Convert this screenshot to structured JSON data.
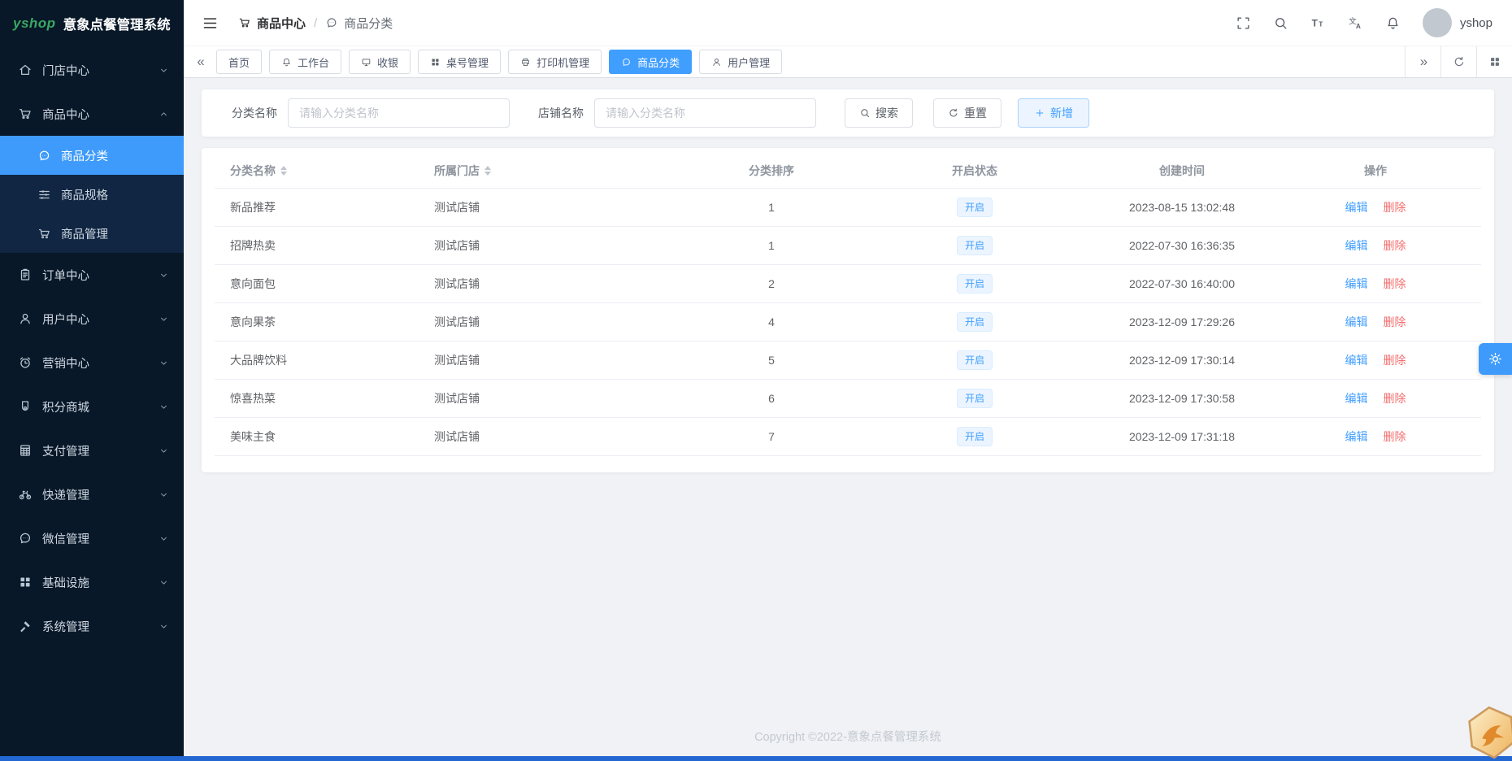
{
  "colors": {
    "accent": "#409eff",
    "sidebar_bg": "#081828",
    "submenu_bg": "#102642",
    "danger": "#f56c6c",
    "badge_bg": "#ecf5ff"
  },
  "app": {
    "logo_text": "yshop",
    "title": "意象点餐管理系统",
    "username": "yshop"
  },
  "header": {
    "breadcrumb": [
      {
        "icon": "cart",
        "label": "商品中心"
      },
      {
        "icon": "comment",
        "label": "商品分类"
      }
    ]
  },
  "sidebar": {
    "items": [
      {
        "icon": "home",
        "label": "门店中心",
        "chevron": "down"
      },
      {
        "icon": "cart",
        "label": "商品中心",
        "chevron": "up",
        "expanded": true,
        "children": [
          {
            "icon": "comment",
            "label": "商品分类",
            "active": true
          },
          {
            "icon": "sliders",
            "label": "商品规格"
          },
          {
            "icon": "cart",
            "label": "商品管理"
          }
        ]
      },
      {
        "icon": "clipboard",
        "label": "订单中心",
        "chevron": "down"
      },
      {
        "icon": "user",
        "label": "用户中心",
        "chevron": "down"
      },
      {
        "icon": "alarm",
        "label": "营销中心",
        "chevron": "down"
      },
      {
        "icon": "medal",
        "label": "积分商城",
        "chevron": "down"
      },
      {
        "icon": "calculator",
        "label": "支付管理",
        "chevron": "down"
      },
      {
        "icon": "bike",
        "label": "快递管理",
        "chevron": "down"
      },
      {
        "icon": "comment",
        "label": "微信管理",
        "chevron": "down"
      },
      {
        "icon": "grid",
        "label": "基础设施",
        "chevron": "down"
      },
      {
        "icon": "gavel",
        "label": "系统管理",
        "chevron": "down"
      }
    ]
  },
  "tabs": [
    {
      "label": "首页"
    },
    {
      "icon": "bell",
      "label": "工作台"
    },
    {
      "icon": "monitor",
      "label": "收银"
    },
    {
      "icon": "grid",
      "label": "桌号管理"
    },
    {
      "icon": "printer",
      "label": "打印机管理"
    },
    {
      "icon": "comment",
      "label": "商品分类",
      "active": true
    },
    {
      "icon": "user",
      "label": "用户管理"
    }
  ],
  "filters": {
    "category_label": "分类名称",
    "category_placeholder": "请输入分类名称",
    "shop_label": "店铺名称",
    "shop_placeholder": "请输入分类名称",
    "search_button": "搜索",
    "reset_button": "重置",
    "add_button": "新增"
  },
  "table": {
    "columns": [
      {
        "label": "分类名称",
        "sortable": true
      },
      {
        "label": "所属门店",
        "sortable": true
      },
      {
        "label": "分类排序"
      },
      {
        "label": "开启状态"
      },
      {
        "label": "创建时间"
      },
      {
        "label": "操作"
      }
    ],
    "edit_label": "编辑",
    "delete_label": "删除",
    "rows": [
      {
        "name": "新品推荐",
        "shop": "测试店铺",
        "sort": "1",
        "status": "开启",
        "created": "2023-08-15 13:02:48"
      },
      {
        "name": "招牌热卖",
        "shop": "测试店铺",
        "sort": "1",
        "status": "开启",
        "created": "2022-07-30 16:36:35"
      },
      {
        "name": "意向面包",
        "shop": "测试店铺",
        "sort": "2",
        "status": "开启",
        "created": "2022-07-30 16:40:00"
      },
      {
        "name": "意向果茶",
        "shop": "测试店铺",
        "sort": "4",
        "status": "开启",
        "created": "2023-12-09 17:29:26"
      },
      {
        "name": "大品牌饮料",
        "shop": "测试店铺",
        "sort": "5",
        "status": "开启",
        "created": "2023-12-09 17:30:14"
      },
      {
        "name": "惊喜热菜",
        "shop": "测试店铺",
        "sort": "6",
        "status": "开启",
        "created": "2023-12-09 17:30:58"
      },
      {
        "name": "美味主食",
        "shop": "测试店铺",
        "sort": "7",
        "status": "开启",
        "created": "2023-12-09 17:31:18"
      }
    ]
  },
  "footer": {
    "copyright": "Copyright ©2022-意象点餐管理系统"
  }
}
